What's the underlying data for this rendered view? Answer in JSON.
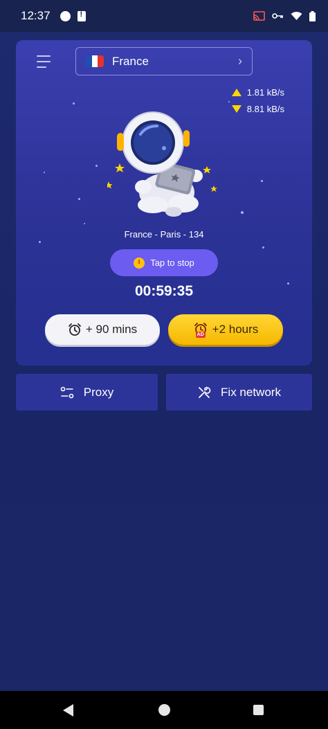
{
  "status_bar": {
    "time": "12:37"
  },
  "header": {
    "country": "France",
    "flag_colors": [
      "#1f4fb5",
      "#ffffff",
      "#e3342b"
    ]
  },
  "speed": {
    "upload": "1.81 kB/s",
    "download": "8.81 kB/s"
  },
  "connection": {
    "server": "France - Paris - 134",
    "stop_label": "Tap to stop",
    "timer": "00:59:35"
  },
  "time_buttons": {
    "add_minutes_label": "+ 90 mins",
    "add_hours_label": "+2 hours",
    "ad_badge": "AD"
  },
  "actions": {
    "proxy_label": "Proxy",
    "fix_network_label": "Fix network"
  },
  "colors": {
    "card_top": "#3b3fb0",
    "accent_purple": "#6c5cf0",
    "accent_yellow": "#ffd600",
    "background": "#1b2466"
  },
  "icons": [
    "menu-icon",
    "chevron-right-icon",
    "upload-arrow-icon",
    "download-arrow-icon",
    "alarm-clock-icon",
    "ad-clock-icon",
    "proxy-icon",
    "tools-icon"
  ]
}
